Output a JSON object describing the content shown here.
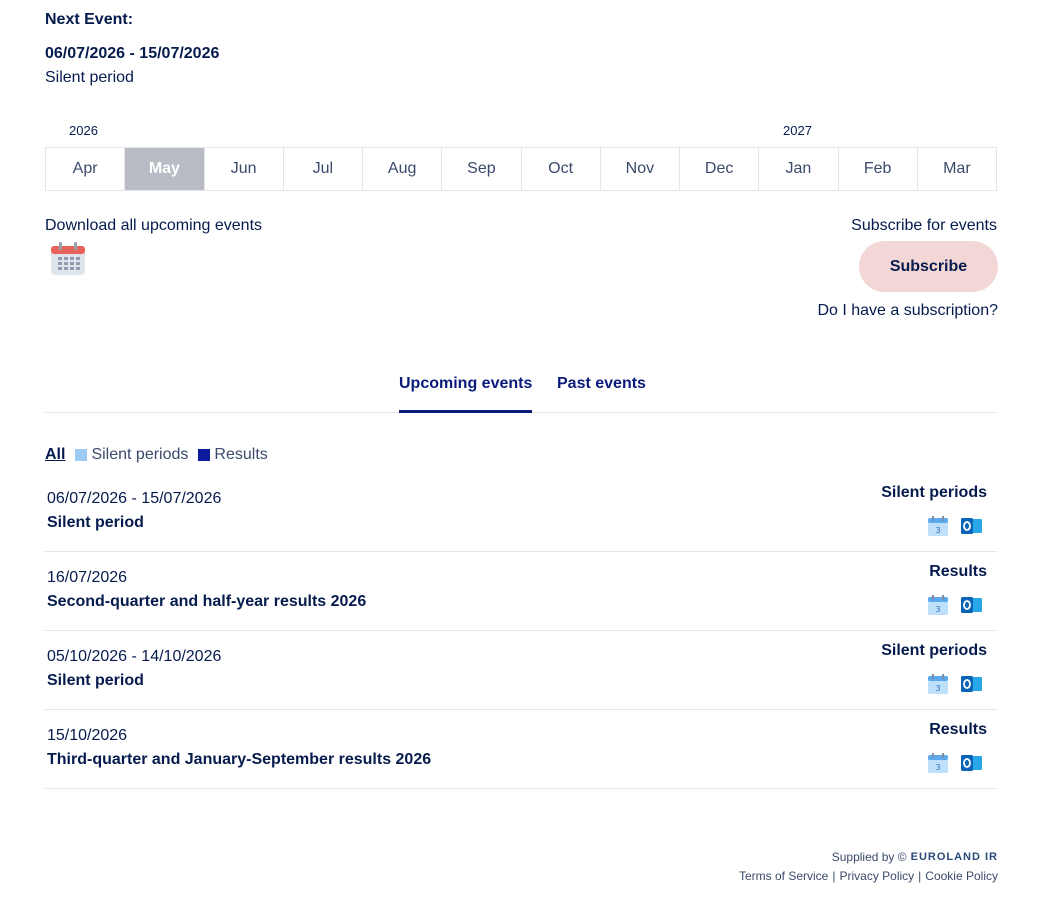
{
  "next_event": {
    "label": "Next Event:",
    "date": "06/07/2026 - 15/07/2026",
    "name": "Silent period"
  },
  "timeline": {
    "years": [
      "2026",
      "2027"
    ],
    "months": [
      "Apr",
      "May",
      "Jun",
      "Jul",
      "Aug",
      "Sep",
      "Oct",
      "Nov",
      "Dec",
      "Jan",
      "Feb",
      "Mar"
    ],
    "active_month": "May"
  },
  "download": {
    "label": "Download all upcoming events",
    "icon": "calendar-icon"
  },
  "subscribe": {
    "label": "Subscribe for events",
    "button": "Subscribe",
    "link": "Do I have a subscription?"
  },
  "tabs": {
    "upcoming": "Upcoming events",
    "past": "Past events"
  },
  "filters": {
    "all": "All",
    "silent": "Silent periods",
    "results": "Results",
    "silent_color": "#9ecbf4",
    "results_color": "#0a1b9c"
  },
  "events": [
    {
      "date": "06/07/2026 - 15/07/2026",
      "name": "Silent period",
      "category": "Silent periods"
    },
    {
      "date": "16/07/2026",
      "name": "Second-quarter and half-year results 2026",
      "category": "Results"
    },
    {
      "date": "05/10/2026 - 14/10/2026",
      "name": "Silent period",
      "category": "Silent periods"
    },
    {
      "date": "15/10/2026",
      "name": "Third-quarter and January-September results 2026",
      "category": "Results"
    }
  ],
  "footer": {
    "supplied_by": "Supplied by ©",
    "logo_text": "EUROLAND IR",
    "terms": "Terms of Service",
    "privacy": "Privacy Policy",
    "cookie": "Cookie Policy"
  }
}
